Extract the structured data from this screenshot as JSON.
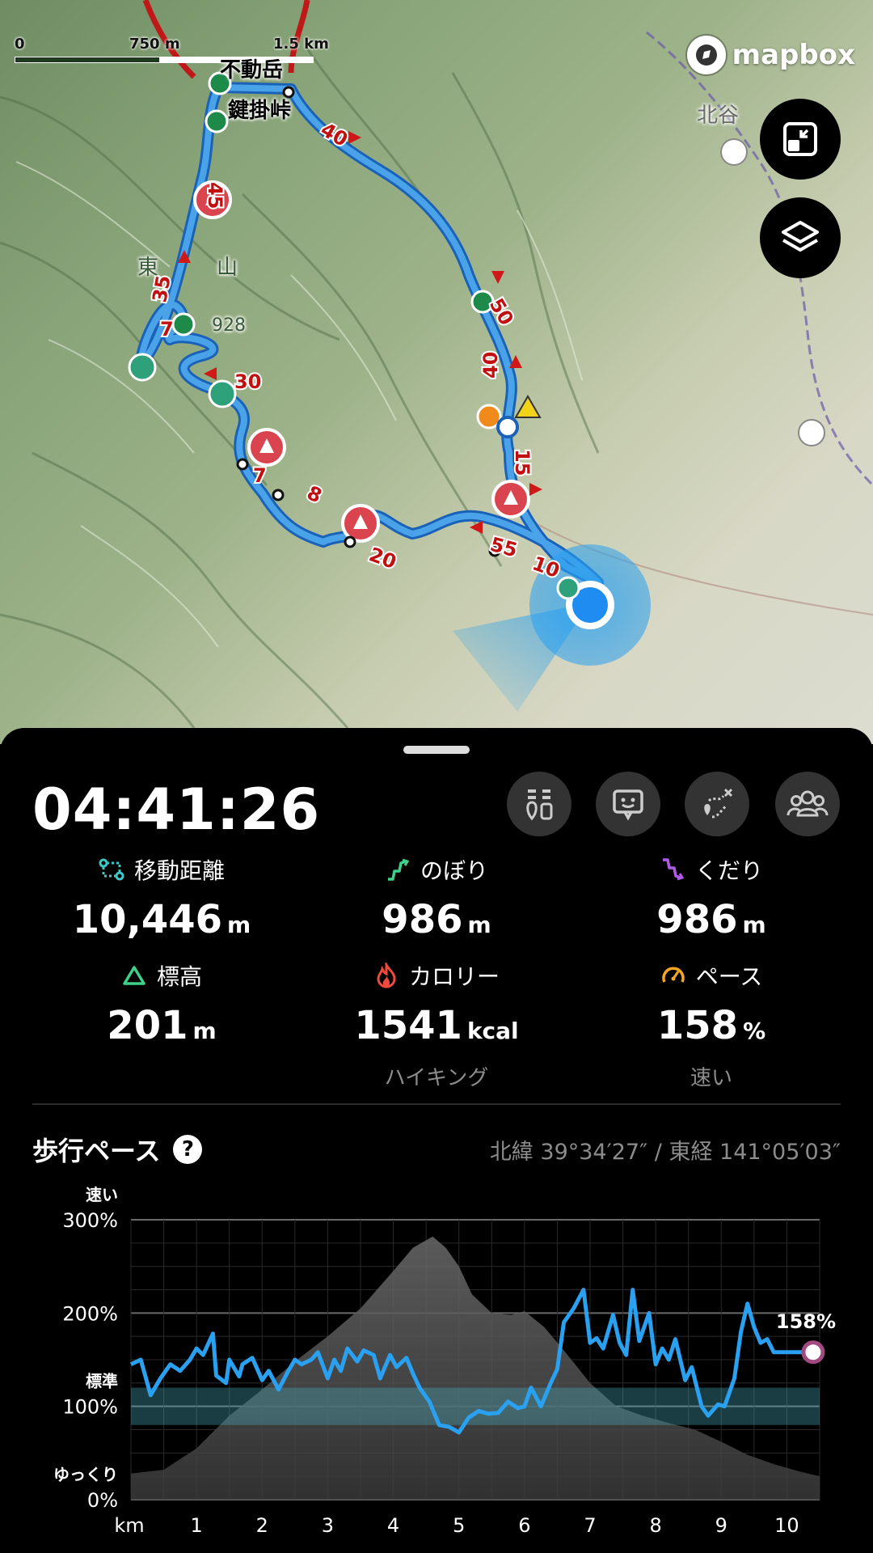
{
  "map": {
    "scale": {
      "zero": "0",
      "mid": "750 m",
      "max": "1.5 km"
    },
    "brand": "mapbox",
    "place_labels": [
      "鍵掛峠",
      "不動岳",
      "北谷",
      "東",
      "山",
      "928"
    ],
    "route_markers": [
      "40",
      "45",
      "35",
      "7",
      "30",
      "7",
      "8",
      "20",
      "55",
      "10",
      "15",
      "40",
      "50"
    ],
    "buttons": {
      "fullscreen_icon": "fullscreen-icon",
      "layers_icon": "layers-icon"
    }
  },
  "sheet": {
    "timer": "04:41:26",
    "actions": [
      {
        "name": "gear-list-icon"
      },
      {
        "name": "chat-message-icon"
      },
      {
        "name": "route-pin-icon"
      },
      {
        "name": "group-members-icon"
      }
    ],
    "stats": {
      "distance": {
        "label": "移動距離",
        "value": "10,446",
        "unit": "m"
      },
      "ascent": {
        "label": "のぼり",
        "value": "986",
        "unit": "m"
      },
      "descent": {
        "label": "くだり",
        "value": "986",
        "unit": "m"
      },
      "altitude": {
        "label": "標高",
        "value": "201",
        "unit": "m"
      },
      "calorie": {
        "label": "カロリー",
        "value": "1541",
        "unit": "kcal",
        "sub": "ハイキング"
      },
      "pace": {
        "label": "ペース",
        "value": "158",
        "unit": "%",
        "sub": "速い"
      }
    },
    "pace_section": {
      "title": "歩行ペース",
      "help": "?",
      "coords": "北緯 39°34′27″ / 東経 141°05′03″"
    }
  },
  "chart_data": {
    "type": "line",
    "title": "歩行ペース",
    "xlabel": "km",
    "x_ticks": [
      "1",
      "2",
      "3",
      "4",
      "5",
      "6",
      "7",
      "8",
      "9",
      "10"
    ],
    "y_ticks": [
      "300%",
      "200%",
      "100%",
      "0%"
    ],
    "y_labels": {
      "fast": "速い",
      "standard": "標準",
      "slow": "ゆっくり"
    },
    "xlim": [
      0,
      10.5
    ],
    "ylim": [
      0,
      300
    ],
    "standard_band": [
      80,
      120
    ],
    "current_label": "158%",
    "pace_series": {
      "x": [
        0,
        0.15,
        0.3,
        0.45,
        0.6,
        0.75,
        0.9,
        1.0,
        1.1,
        1.25,
        1.3,
        1.45,
        1.5,
        1.65,
        1.7,
        1.85,
        2.0,
        2.1,
        2.25,
        2.4,
        2.5,
        2.6,
        2.75,
        2.85,
        3.0,
        3.1,
        3.2,
        3.3,
        3.45,
        3.55,
        3.7,
        3.8,
        3.95,
        4.05,
        4.2,
        4.3,
        4.4,
        4.55,
        4.7,
        4.85,
        5.0,
        5.15,
        5.3,
        5.45,
        5.6,
        5.75,
        5.9,
        6.0,
        6.1,
        6.25,
        6.4,
        6.5,
        6.6,
        6.75,
        6.9,
        7.0,
        7.1,
        7.2,
        7.35,
        7.45,
        7.55,
        7.65,
        7.75,
        7.9,
        8.0,
        8.1,
        8.2,
        8.3,
        8.45,
        8.55,
        8.7,
        8.8,
        8.95,
        9.05,
        9.2,
        9.3,
        9.4,
        9.5,
        9.6,
        9.7,
        9.8,
        9.9,
        10.0,
        10.1,
        10.2,
        10.4
      ],
      "y": [
        145,
        150,
        112,
        130,
        145,
        138,
        150,
        162,
        155,
        178,
        133,
        125,
        150,
        132,
        145,
        152,
        128,
        138,
        118,
        138,
        150,
        145,
        150,
        158,
        130,
        150,
        138,
        162,
        148,
        160,
        155,
        130,
        155,
        142,
        152,
        135,
        120,
        105,
        80,
        78,
        72,
        88,
        95,
        92,
        93,
        105,
        98,
        100,
        120,
        100,
        125,
        140,
        190,
        205,
        225,
        168,
        173,
        162,
        198,
        168,
        155,
        225,
        170,
        200,
        145,
        162,
        150,
        172,
        128,
        142,
        100,
        90,
        102,
        100,
        130,
        180,
        210,
        185,
        168,
        172,
        158,
        158,
        158,
        158,
        158,
        158
      ]
    },
    "elevation_series": {
      "x": [
        0,
        0.5,
        1.0,
        1.5,
        2.0,
        2.5,
        3.0,
        3.5,
        4.0,
        4.3,
        4.6,
        4.8,
        5.0,
        5.2,
        5.5,
        5.8,
        6.0,
        6.3,
        6.6,
        7.0,
        7.4,
        7.8,
        8.2,
        8.6,
        9.0,
        9.4,
        9.8,
        10.2,
        10.5
      ],
      "y": [
        28,
        32,
        55,
        90,
        118,
        148,
        175,
        205,
        245,
        270,
        282,
        270,
        250,
        220,
        200,
        198,
        202,
        185,
        160,
        125,
        100,
        90,
        82,
        75,
        62,
        48,
        38,
        30,
        25
      ]
    }
  }
}
